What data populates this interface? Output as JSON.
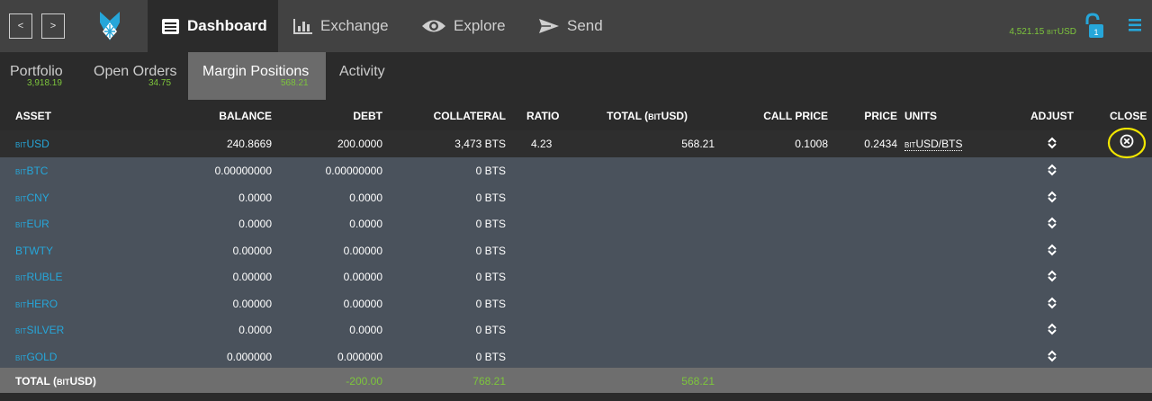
{
  "nav": {
    "back_label": "<",
    "forward_label": ">",
    "items": [
      {
        "label": "Dashboard",
        "icon": "dashboard-icon",
        "active": true
      },
      {
        "label": "Exchange",
        "icon": "bar-chart-icon",
        "active": false
      },
      {
        "label": "Explore",
        "icon": "eye-icon",
        "active": false
      },
      {
        "label": "Send",
        "icon": "paper-plane-icon",
        "active": false
      }
    ],
    "account_balance_value": "4,521.15",
    "account_balance_prefix": "bit",
    "account_balance_unit": "USD",
    "lock_badge": "1",
    "lock_icon": "unlocked-padlock-icon",
    "menu_icon": "hamburger-menu-icon",
    "logo_icon": "bitshares-logo-icon"
  },
  "tabs": [
    {
      "label": "Portfolio",
      "value": "3,918.19",
      "active": false
    },
    {
      "label": "Open Orders",
      "value": "34.75",
      "active": false
    },
    {
      "label": "Margin Positions",
      "value": "568.21",
      "active": true
    },
    {
      "label": "Activity",
      "value": "",
      "active": false
    }
  ],
  "table": {
    "headers": {
      "asset": "ASSET",
      "balance": "BALANCE",
      "debt": "DEBT",
      "collateral": "COLLATERAL",
      "ratio": "RATIO",
      "total_prefix": "TOTAL (",
      "total_bit": "BIT",
      "total_suffix": "USD)",
      "call_price": "CALL PRICE",
      "price": "PRICE",
      "units": "UNITS",
      "adjust": "ADJUST",
      "close": "CLOSE"
    },
    "rows": [
      {
        "prefix": "bit",
        "name": "USD",
        "balance": "240.8669",
        "debt": "200.0000",
        "collateral": "3,473 BTS",
        "ratio": "4.23",
        "total": "568.21",
        "call_price": "0.1008",
        "price": "0.2434",
        "units_prefix": "bit",
        "units": "USD/BTS"
      },
      {
        "prefix": "bit",
        "name": "BTC",
        "balance": "0.00000000",
        "debt": "0.00000000",
        "collateral": "0 BTS"
      },
      {
        "prefix": "bit",
        "name": "CNY",
        "balance": "0.0000",
        "debt": "0.0000",
        "collateral": "0 BTS"
      },
      {
        "prefix": "bit",
        "name": "EUR",
        "balance": "0.0000",
        "debt": "0.0000",
        "collateral": "0 BTS"
      },
      {
        "prefix": "",
        "name": "BTWTY",
        "balance": "0.00000",
        "debt": "0.00000",
        "collateral": "0 BTS"
      },
      {
        "prefix": "bit",
        "name": "RUBLE",
        "balance": "0.00000",
        "debt": "0.00000",
        "collateral": "0 BTS"
      },
      {
        "prefix": "bit",
        "name": "HERO",
        "balance": "0.00000",
        "debt": "0.00000",
        "collateral": "0 BTS"
      },
      {
        "prefix": "bit",
        "name": "SILVER",
        "balance": "0.0000",
        "debt": "0.0000",
        "collateral": "0 BTS"
      },
      {
        "prefix": "bit",
        "name": "GOLD",
        "balance": "0.000000",
        "debt": "0.000000",
        "collateral": "0 BTS"
      }
    ],
    "footer": {
      "label_prefix": "TOTAL (",
      "label_bit": "BIT",
      "label_suffix": "USD)",
      "debt": "-200.00",
      "collateral": "768.21",
      "total": "568.21"
    }
  },
  "colors": {
    "accent": "#26a6d9",
    "green": "#7dc53c",
    "highlight_ring": "#f2e600"
  }
}
